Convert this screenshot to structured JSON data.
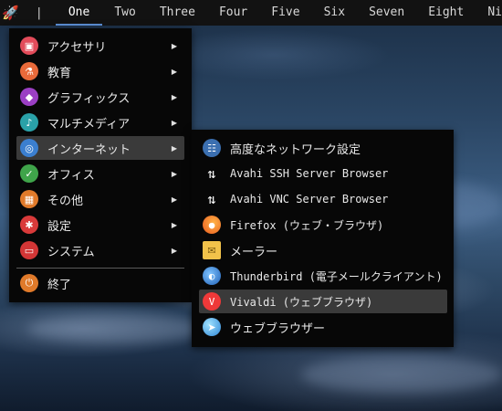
{
  "panel": {
    "separator": "|",
    "workspaces": [
      "One",
      "Two",
      "Three",
      "Four",
      "Five",
      "Six",
      "Seven",
      "Eight",
      "Ni"
    ],
    "active_workspace": "One"
  },
  "main_menu": {
    "items": [
      {
        "label": "アクセサリ",
        "icon": "accessories-icon",
        "color": "#e24b5a",
        "glyph": "▣"
      },
      {
        "label": "教育",
        "icon": "education-icon",
        "color": "#e96a3a",
        "glyph": "⚗"
      },
      {
        "label": "グラフィックス",
        "icon": "graphics-icon",
        "color": "#9b3fc4",
        "glyph": "◆"
      },
      {
        "label": "マルチメディア",
        "icon": "multimedia-icon",
        "color": "#2aa1a8",
        "glyph": "♪"
      },
      {
        "label": "インターネット",
        "icon": "internet-icon",
        "color": "#3b7fd0",
        "glyph": "◎"
      },
      {
        "label": "オフィス",
        "icon": "office-icon",
        "color": "#3fa44a",
        "glyph": "✓"
      },
      {
        "label": "その他",
        "icon": "other-icon",
        "color": "#e07a2a",
        "glyph": "▦"
      },
      {
        "label": "設定",
        "icon": "settings-icon",
        "color": "#d93a3a",
        "glyph": "✱"
      },
      {
        "label": "システム",
        "icon": "system-icon",
        "color": "#d33636",
        "glyph": "▭"
      }
    ],
    "exit": {
      "label": "終了",
      "icon": "exit-icon",
      "color": "#e07a2a",
      "glyph": "⏻"
    },
    "arrow": "▶"
  },
  "internet_menu": {
    "items": [
      {
        "label": "高度なネットワーク設定",
        "icon": "network-settings-icon"
      },
      {
        "label": "Avahi SSH Server Browser",
        "icon": "avahi-ssh-icon"
      },
      {
        "label": "Avahi VNC Server Browser",
        "icon": "avahi-vnc-icon"
      },
      {
        "label": "Firefox (ウェブ・ブラウザ)",
        "icon": "firefox-icon"
      },
      {
        "label": "メーラー",
        "icon": "mailer-icon"
      },
      {
        "label": "Thunderbird (電子メールクライアント)",
        "icon": "thunderbird-icon"
      },
      {
        "label": "Vivaldi (ウェブブラウザ)",
        "icon": "vivaldi-icon"
      },
      {
        "label": "ウェブブラウザー",
        "icon": "web-browser-icon"
      }
    ]
  },
  "colors": {
    "menu_bg": "#070707",
    "highlight": "#3a3a3a",
    "panel_bg": "#121212",
    "active_underline": "#5c8fd6"
  }
}
